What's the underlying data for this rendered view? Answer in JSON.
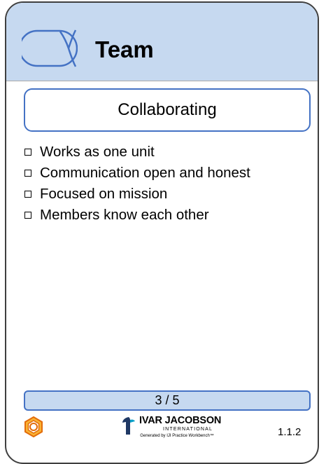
{
  "card": {
    "alpha_name": "Team",
    "state_name": "Collaborating",
    "checklist": [
      "Works as one unit",
      "Communication open and honest",
      "Focused on mission",
      "Members know each other"
    ],
    "progress": {
      "label": "3 / 5",
      "current": 3,
      "total": 5
    },
    "footer": {
      "gear_icon": "gear-icon",
      "logo_name": "IVAR JACOBSON",
      "logo_subtitle": "INTERNATIONAL",
      "generated_by": "Generated by IJI Practice Workbench™",
      "version": "1.1.2"
    }
  },
  "colors": {
    "header_bg": "#c6d9f0",
    "accent_blue": "#4472c4",
    "gear_orange": "#e36c0a",
    "card_border": "#3f3f3f"
  }
}
